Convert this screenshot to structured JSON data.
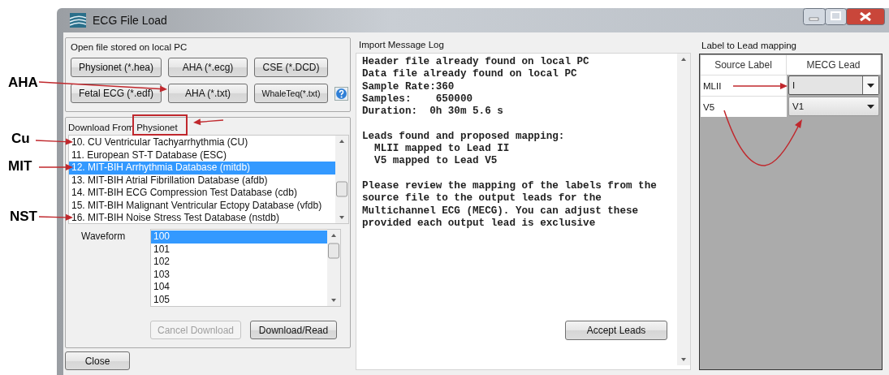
{
  "window": {
    "title": "ECG File Load"
  },
  "local_file": {
    "title": "Open file stored on local PC",
    "buttons": [
      {
        "label": "Physionet (*.hea)"
      },
      {
        "label": "AHA (*.ecg)"
      },
      {
        "label": "CSE (*.DCD)"
      },
      {
        "label": "Fetal ECG (*.edf)"
      },
      {
        "label": "AHA (*.txt)"
      },
      {
        "label": "WhaleTeq(*.txt)"
      }
    ]
  },
  "download": {
    "title": "Download From",
    "source": "Physionet",
    "databases": [
      {
        "label": "10. CU Ventricular Tachyarrhythmia (CU)",
        "selected": false
      },
      {
        "label": "11. European ST-T Database (ESC)",
        "selected": false
      },
      {
        "label": "12. MIT-BIH Arrhythmia Database (mitdb)",
        "selected": true
      },
      {
        "label": "13. MIT-BIH Atrial Fibrillation Database (afdb)",
        "selected": false
      },
      {
        "label": "14. MIT-BIH ECG Compression Test Database (cdb)",
        "selected": false
      },
      {
        "label": "15. MIT-BIH Malignant Ventricular Ectopy Database (vfdb)",
        "selected": false
      },
      {
        "label": "16. MIT-BIH Noise Stress Test Database (nstdb)",
        "selected": false
      }
    ],
    "waveform_label": "Waveform",
    "waveforms": [
      {
        "label": "100",
        "selected": true
      },
      {
        "label": "101",
        "selected": false
      },
      {
        "label": "102",
        "selected": false
      },
      {
        "label": "103",
        "selected": false
      },
      {
        "label": "104",
        "selected": false
      },
      {
        "label": "105",
        "selected": false
      }
    ],
    "buttons": [
      {
        "label": "Cancel Download",
        "disabled": true
      },
      {
        "label": "Download/Read",
        "disabled": false
      }
    ]
  },
  "close_button": "Close",
  "message_log": {
    "title": "Import Message Log",
    "paragraphs": [
      [
        "Header file already found on local PC",
        "Data file already found on local PC",
        "Sample Rate:360",
        "Samples:    650000",
        "Duration:  0h 30m 5.6 s"
      ],
      [
        "Leads found and proposed mapping:",
        "  MLII mapped to Lead II",
        "  V5 mapped to Lead V5"
      ],
      [
        "Please review the mapping of the labels from the",
        "source file to the output leads for the",
        "Multichannel ECG (MECG). You can adjust these",
        "provided each output lead is exclusive"
      ]
    ],
    "button": "Accept Leads"
  },
  "lead_mapping": {
    "title": "Label to Lead mapping",
    "columns": [
      "Source Label",
      "MECG Lead"
    ],
    "rows": [
      {
        "source": "MLII",
        "lead": "I",
        "focused": true
      },
      {
        "source": "V5",
        "lead": "V1",
        "focused": false
      }
    ]
  },
  "annotations": [
    {
      "label": "AHA"
    },
    {
      "label": "Cu"
    },
    {
      "label": "MIT"
    },
    {
      "label": "NST"
    }
  ]
}
